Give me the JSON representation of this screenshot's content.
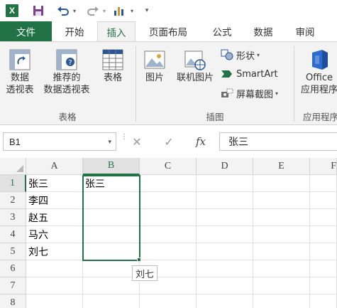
{
  "quick_access": {
    "app_logo": "X",
    "icons": [
      "excel-logo-icon",
      "save-icon",
      "undo-icon",
      "redo-icon",
      "chart-icon",
      "customize-icon"
    ]
  },
  "tabs": [
    {
      "label": "文件"
    },
    {
      "label": "开始"
    },
    {
      "label": "插入"
    },
    {
      "label": "页面布局"
    },
    {
      "label": "公式"
    },
    {
      "label": "数据"
    },
    {
      "label": "审阅"
    }
  ],
  "active_tab": "插入",
  "ribbon": {
    "pivot_table_line1": "数据",
    "pivot_table_line2": "透视表",
    "recommended_pivot_line1": "推荐的",
    "recommended_pivot_line2": "数据透视表",
    "table": "表格",
    "group_tables": "表格",
    "picture": "图片",
    "online_picture": "联机图片",
    "shapes": "形状",
    "smartart": "SmartArt",
    "screenshot": "屏幕截图",
    "group_illustrations": "插图",
    "office_app_line1": "Office",
    "office_app_line2": "应用程序",
    "group_apps": "应用程序"
  },
  "formula_bar": {
    "name_box": "B1",
    "cancel_symbol": "✕",
    "enter_symbol": "✓",
    "fx_label": "fx",
    "content": "张三"
  },
  "grid": {
    "columns": [
      "A",
      "B",
      "C",
      "D",
      "E",
      "F"
    ],
    "rows": [
      "1",
      "2",
      "3",
      "4",
      "5",
      "6",
      "7",
      "8"
    ],
    "selected_cell": "B1",
    "cells": {
      "A1": "张三",
      "A2": "李四",
      "A3": "赵五",
      "A4": "马六",
      "A5": "刘七",
      "B1": "张三"
    },
    "autocomplete_tip": "刘七"
  },
  "colors": {
    "excel_green": "#217346",
    "ribbon_bg": "#f3f3f3",
    "header_bg": "#f3f3f3"
  }
}
